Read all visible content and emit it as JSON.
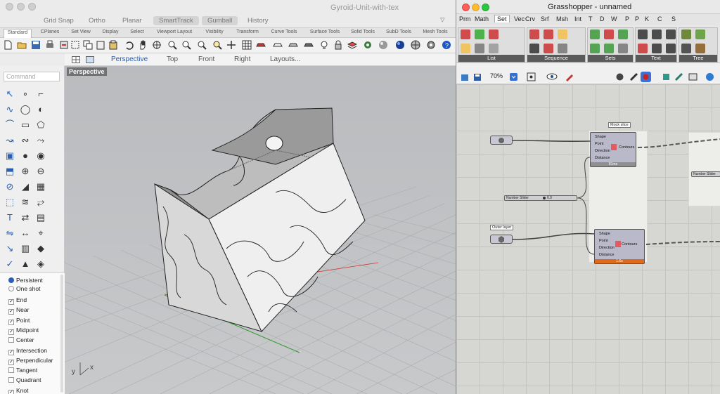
{
  "rhino": {
    "title": "Gyroid-Unit-with-tex",
    "toolbar_buttons": [
      "Grid Snap",
      "Ortho",
      "Planar",
      "SmartTrack",
      "Gumball",
      "History"
    ],
    "tabs": [
      "Standard",
      "CPlanes",
      "Set View",
      "Display",
      "Select",
      "Viewport Layout",
      "Visibility",
      "Transform",
      "Curve Tools",
      "Surface Tools",
      "Solid Tools",
      "SubD Tools",
      "Mesh Tools"
    ],
    "viewport_tabs": [
      "Perspective",
      "Top",
      "Front",
      "Right",
      "Layouts..."
    ],
    "command_placeholder": "Command",
    "viewport_label": "Perspective",
    "osnap_mode": [
      {
        "label": "Persistent",
        "selected": true
      },
      {
        "label": "One shot",
        "selected": false
      }
    ],
    "osnaps": [
      {
        "label": "End",
        "checked": true
      },
      {
        "label": "Near",
        "checked": true
      },
      {
        "label": "Point",
        "checked": true
      },
      {
        "label": "Midpoint",
        "checked": true
      },
      {
        "label": "Center",
        "checked": false
      },
      {
        "label": "Intersection",
        "checked": true
      },
      {
        "label": "Perpendicular",
        "checked": true
      },
      {
        "label": "Tangent",
        "checked": false
      },
      {
        "label": "Quadrant",
        "checked": false
      },
      {
        "label": "Knot",
        "checked": true
      }
    ],
    "axis_x": "x",
    "axis_y": "y"
  },
  "grasshopper": {
    "title": "Grasshopper - unnamed",
    "tabs": [
      "Prm",
      "Math",
      "Set",
      "Vec",
      "Crv",
      "Srf",
      "Msh",
      "Int",
      "T",
      "D",
      "W",
      "P",
      "P",
      "K",
      "C",
      "S"
    ],
    "active_tab": "Set",
    "panels": [
      "List",
      "Sequence",
      "Sets",
      "Text",
      "Tree"
    ],
    "zoom": "70%",
    "notes": [
      "Mock slice",
      "Outer layer"
    ],
    "component": {
      "inputs": [
        "Shape",
        "Point",
        "Direction",
        "Distance"
      ],
      "output": "Contours",
      "timer1": "81ms",
      "timer2": "1.6s"
    },
    "slider_label": "Number Slider",
    "slider_value": "0.0",
    "slider_label_2": "Number Slider"
  },
  "colors": {
    "accent": "#2a5fb3",
    "gh_orange": "#e06a1c",
    "gh_grey": "#8f8f8f",
    "rhino_red": "#cc3333",
    "rhino_green": "#2f9a2f"
  }
}
